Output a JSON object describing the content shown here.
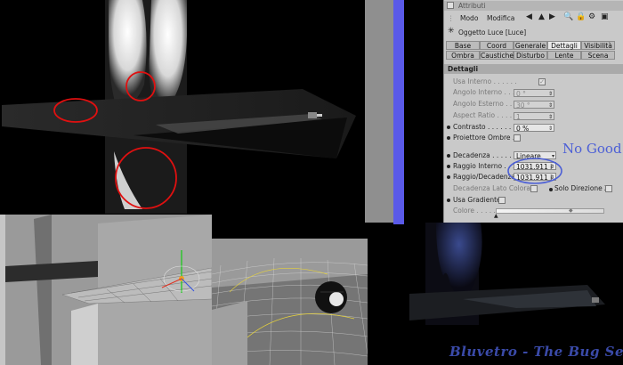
{
  "panel": {
    "title": "Attributi",
    "menu": [
      "Modo",
      "Modifica"
    ],
    "object_name": "Oggetto Luce [Luce]",
    "tabs_row1": [
      "Base",
      "Coord",
      "Generale",
      "Dettagli",
      "Visibilità"
    ],
    "tabs_row2": [
      "Ombra",
      "Caustiche",
      "Disturbo",
      "Lente",
      "Scena"
    ],
    "active_tab": "Dettagli",
    "section_title": "Dettagli",
    "params": {
      "usa_interno": "Usa Interno . . . . . .",
      "angolo_interno": "Angolo Interno . . .",
      "angolo_interno_val": "0 °",
      "angolo_esterno": "Angolo Esterno . . .",
      "angolo_esterno_val": "30 °",
      "aspect_ratio": "Aspect Ratio . . . .",
      "aspect_ratio_val": "1",
      "contrasto": "Contrasto . . . . . .",
      "contrasto_val": "0 %",
      "proiettore_ombre": "Proiettore Ombre . .",
      "decadenza": "Decadenza . . . . . .",
      "decadenza_val": "Lineare",
      "raggio_interno": "Raggio Interno . . .",
      "raggio_interno_val": "1031.911 i",
      "raggio_decadenza": "Raggio/Decadenza",
      "raggio_decadenza_val": "1031.911 i",
      "decadenza_lato": "Decadenza Lato Colorata",
      "solo_direzione": "Solo Direzione Z",
      "usa_gradiente": "Usa Gradiente",
      "colore": "Colore . . . . ."
    }
  },
  "annotation": "No Good",
  "signature": "Bluvetro - The Bug Seeker",
  "colors": {
    "panel_bg": "#c9c9c9",
    "blue_bar": "#5a5ae8",
    "annotation_red": "#e01010",
    "annotation_blue": "#4c5fd6",
    "signature_blue": "#3a4aa8"
  }
}
